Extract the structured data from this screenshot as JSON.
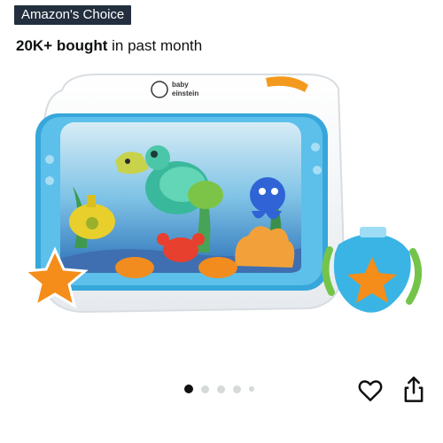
{
  "badge": {
    "label": "Amazon's Choice"
  },
  "purchase_stats": {
    "count": "20K+ bought",
    "suffix": " in past month"
  },
  "product_image": {
    "brand_logo_text": "baby einstein"
  },
  "carousel": {
    "total": 5,
    "active_index": 0
  },
  "actions": {
    "wishlist_icon": "heart-icon",
    "share_icon": "share-icon"
  },
  "colors": {
    "badge_bg": "#232f3e",
    "badge_text": "#ffffff",
    "active_dot": "#0f1111",
    "inactive_dot": "#d5d9d9"
  }
}
